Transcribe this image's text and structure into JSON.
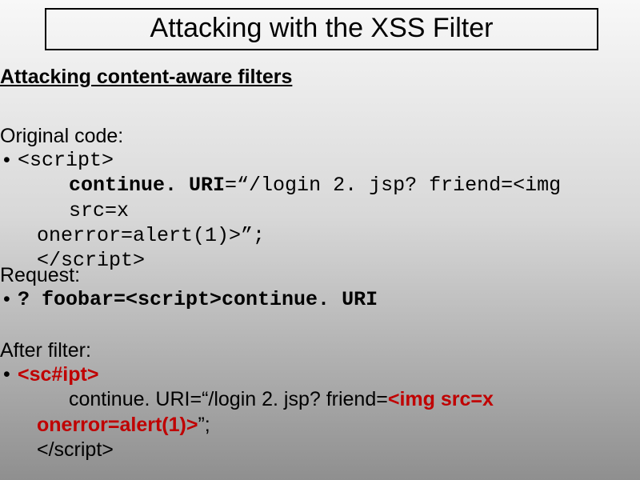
{
  "title": "Attacking with the XSS Filter",
  "subtitle": "Attacking content-aware filters",
  "original": {
    "label": "Original code:",
    "line1_open": "<script>",
    "line2_pre": "continue. URI",
    "line2_post": "=“/login 2. jsp? friend=<img src=x",
    "line3": "onerror=alert(1)>”;",
    "line4_close": "</script>"
  },
  "request": {
    "label": "Request:",
    "text": "? foobar=<script>continue. URI"
  },
  "after": {
    "label": "After filter:",
    "line1_open": "<sc#ipt>",
    "line2_pre": "continue. URI=“/login 2. jsp? friend=",
    "line2_red": "<img src=x",
    "line3_red": "onerror=alert(1)>",
    "line3_post": "”;",
    "line4_close": "</script>"
  }
}
